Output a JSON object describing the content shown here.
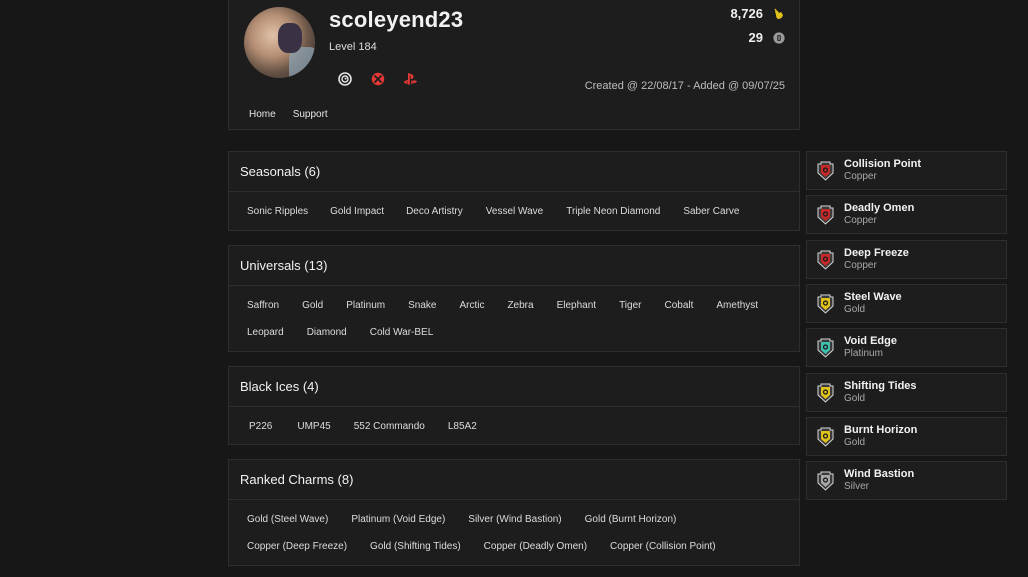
{
  "profile": {
    "username": "scoleyend23",
    "level": "Level 184",
    "renown": "8,726",
    "alpha_packs": "29",
    "created": "Created @ 22/08/17 - Added @ 09/07/25",
    "platforms": [
      "ubisoft-icon",
      "xbox-icon",
      "playstation-icon"
    ]
  },
  "nav": {
    "home": "Home",
    "support": "Support"
  },
  "seasonals": {
    "title": "Seasonals (6)",
    "items": [
      "Sonic Ripples",
      "Gold Impact",
      "Deco Artistry",
      "Vessel Wave",
      "Triple Neon Diamond",
      "Saber Carve"
    ]
  },
  "universals": {
    "title": "Universals (13)",
    "items": [
      "Saffron",
      "Gold",
      "Platinum",
      "Snake",
      "Arctic",
      "Zebra",
      "Elephant",
      "Tiger",
      "Cobalt",
      "Amethyst",
      "Leopard",
      "Diamond",
      "Cold War-BEL"
    ]
  },
  "black_ices": {
    "title": "Black Ices (4)",
    "items": [
      "P226",
      "UMP45",
      "552 Commando",
      "L85A2"
    ]
  },
  "ranked_charms": {
    "title": "Ranked Charms (8)",
    "items": [
      "Gold (Steel Wave)",
      "Platinum (Void Edge)",
      "Silver (Wind Bastion)",
      "Gold (Burnt Horizon)",
      "Copper (Deep Freeze)",
      "Gold (Shifting Tides)",
      "Copper (Deadly Omen)",
      "Copper (Collision Point)"
    ]
  },
  "charm_cards": [
    {
      "name": "Collision Point",
      "rank": "Copper",
      "color": "#c62828"
    },
    {
      "name": "Deadly Omen",
      "rank": "Copper",
      "color": "#c62828"
    },
    {
      "name": "Deep Freeze",
      "rank": "Copper",
      "color": "#c62828"
    },
    {
      "name": "Steel Wave",
      "rank": "Gold",
      "color": "#e0c21b"
    },
    {
      "name": "Void Edge",
      "rank": "Platinum",
      "color": "#3fbfae"
    },
    {
      "name": "Shifting Tides",
      "rank": "Gold",
      "color": "#e0c21b"
    },
    {
      "name": "Burnt Horizon",
      "rank": "Gold",
      "color": "#e0c21b"
    },
    {
      "name": "Wind Bastion",
      "rank": "Silver",
      "color": "#a8a8a8"
    }
  ],
  "colors": {
    "background": "#171717",
    "panel": "#1d1d1d",
    "border": "#2e2e2e",
    "xbox": "#e53935",
    "playstation": "#e53935"
  }
}
